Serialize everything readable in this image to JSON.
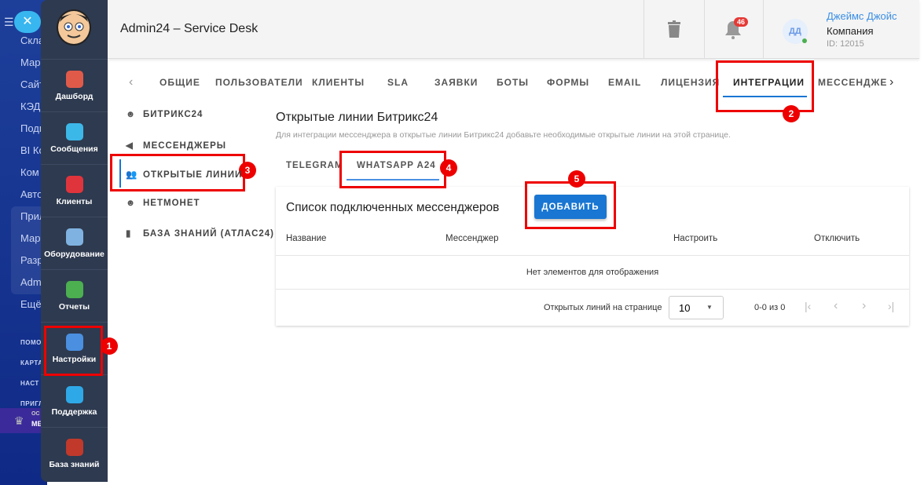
{
  "bg_sidebar": {
    "items": [
      "Скла",
      "Мар",
      "Сайт",
      "КЭД",
      "Подп",
      "BI Ко",
      "Ком",
      "Авто",
      "Прил",
      "Мар",
      "Разр",
      "Adm",
      "Ещё"
    ],
    "small": [
      "ПОМО",
      "КАРТА",
      "НАСТ",
      "ПРИГЛ"
    ],
    "premium": [
      "ОС",
      "МЕ"
    ]
  },
  "nav": {
    "items": [
      {
        "label": "Дашборд",
        "color": "#e05a4a"
      },
      {
        "label": "Сообщения",
        "color": "#3cb8e8"
      },
      {
        "label": "Клиенты",
        "color": "#e0343c"
      },
      {
        "label": "Оборудование",
        "color": "#7fb2e0"
      },
      {
        "label": "Отчеты",
        "color": "#4caf50"
      },
      {
        "label": "Настройки",
        "color": "#4a8fe0"
      },
      {
        "label": "Поддержка",
        "color": "#2fa8e8"
      },
      {
        "label": "База знаний",
        "color": "#c0392b"
      }
    ]
  },
  "header": {
    "title": "Admin24 – Service Desk",
    "notifications": "46",
    "avatar": "ДД",
    "user_name": "Джеймс Джойс",
    "company": "Компания",
    "id": "ID: 12015"
  },
  "tabs": [
    "ОБЩИЕ",
    "ПОЛЬЗОВАТЕЛИ",
    "КЛИЕНТЫ",
    "SLA",
    "ЗАЯВКИ",
    "БОТЫ",
    "ФОРМЫ",
    "EMAIL",
    "ЛИЦЕНЗИЯ",
    "ИНТЕГРАЦИИ",
    "МЕССЕНДЖЕ"
  ],
  "submenu": [
    "БИТРИКС24",
    "МЕССЕНДЖЕРЫ",
    "ОТКРЫТЫЕ ЛИНИИ",
    "НЕТМОНЕТ",
    "БАЗА ЗНАНИЙ (АТЛАС24)"
  ],
  "content": {
    "title": "Открытые линии Битрикс24",
    "desc": "Для интеграции мессенджера в открытые линии Битрикс24 добавьте необходимые открытые линии на этой странице.",
    "subtabs": [
      "TELEGRAM",
      "WHATSAPP A24"
    ],
    "list_title": "Список подключенных мессенджеров",
    "add": "ДОБАВИТЬ",
    "columns": [
      "Название",
      "Мессенджер",
      "Настроить",
      "Отключить"
    ],
    "empty": "Нет элементов для отображения",
    "per_page_label": "Открытых линий на странице",
    "per_page": "10",
    "range": "0-0 из 0"
  },
  "markers": [
    "1",
    "2",
    "3",
    "4",
    "5"
  ]
}
